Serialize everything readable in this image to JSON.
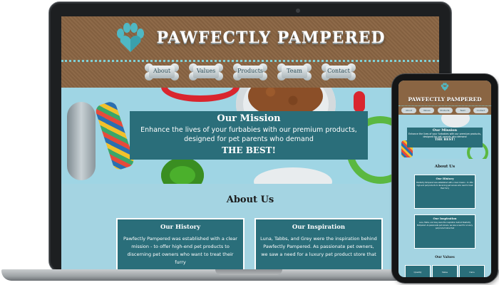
{
  "site": {
    "brand_title": "PAWFECTLY PAMPERED",
    "nav": [
      "About",
      "Values",
      "Products",
      "Team",
      "Contact"
    ]
  },
  "hero": {
    "mission_title": "Our Mission",
    "mission_text": "Enhance the lives of your furbabies with our premium products, designed for pet parents who demand",
    "mission_emphasis": "THE BEST!"
  },
  "about": {
    "heading": "About Us",
    "cards": [
      {
        "title": "Our History",
        "text": "Pawfectly Pampered was established with a clear mission - to offer high-end pet products to discerning pet owners who want to treat their furry"
      },
      {
        "title": "Our Inspiration",
        "text": "Luna, Tabbs, and Grey were the inspiration behind Pawfectly Pampered. As passionate pet owners, we saw a need for a luxury pet product store that"
      }
    ]
  },
  "mobile": {
    "brand_title": "PAWFECTLY PAMPERED",
    "mission_title": "Our Mission",
    "mission_text": "Enhance the lives of your furbabies with our premium products, designed for pet parents who demand",
    "mission_emphasis": "THE BEST!",
    "about_heading": "About Us",
    "history_title": "Our History",
    "inspiration_title": "Our Inspiration",
    "values_heading": "Our Values",
    "value_items": [
      "Quality",
      "Value",
      "Care"
    ]
  },
  "colors": {
    "header_brown": "#8a6543",
    "teal": "#2a6e7a",
    "sky": "#a4d4e2",
    "dots": "#7fd0d6"
  }
}
